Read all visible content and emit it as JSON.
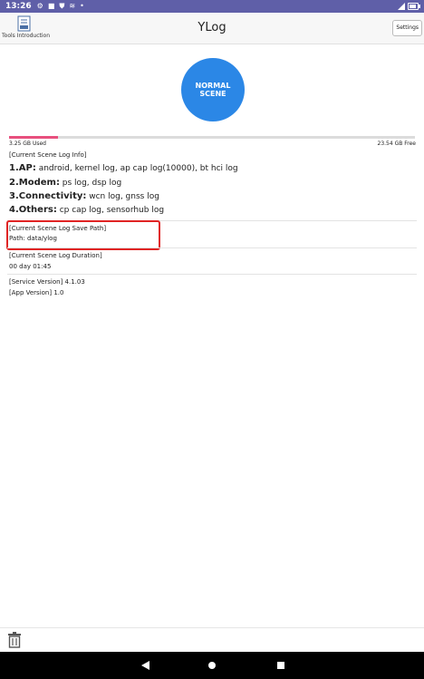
{
  "status_bar": {
    "time": "13:26",
    "icons": [
      "settings-icon",
      "square-icon",
      "shield-icon",
      "wifi-icon",
      "dot-icon"
    ],
    "battery_level": 0.8
  },
  "app_bar": {
    "tools_label": "Tools Introduction",
    "title": "YLog",
    "settings_label": "Settings"
  },
  "scene": {
    "label": "NORMAL SCENE",
    "color": "#2b87e6"
  },
  "storage": {
    "used": "3.25 GB Used",
    "free": "23.54 GB Free",
    "used_fraction": 0.12,
    "fill_color": "#e8507e"
  },
  "info": {
    "header": "[Current Scene Log Info]",
    "lines": [
      {
        "key": "1.AP:",
        "value": " android, kernel log, ap cap log(10000), bt hci log"
      },
      {
        "key": "2.Modem:",
        "value": " ps log, dsp log"
      },
      {
        "key": "3.Connectivity:",
        "value": " wcn log, gnss log"
      },
      {
        "key": "4.Others:",
        "value": " cp cap log, sensorhub log"
      }
    ]
  },
  "save_path": {
    "header": "[Current Scene Log Save Path]",
    "value": "Path: data/ylog",
    "highlight_color": "#e02424"
  },
  "duration": {
    "header": "[Current Scene Log Duration]",
    "value": "00 day 01:45"
  },
  "versions": {
    "service": "[Service Version]  4.1.03",
    "app": "[App Version]  1.0"
  },
  "bottom": {
    "trash_icon": "trash-icon"
  },
  "nav": {
    "back": "back-icon",
    "home": "home-icon",
    "recents": "recents-icon"
  }
}
